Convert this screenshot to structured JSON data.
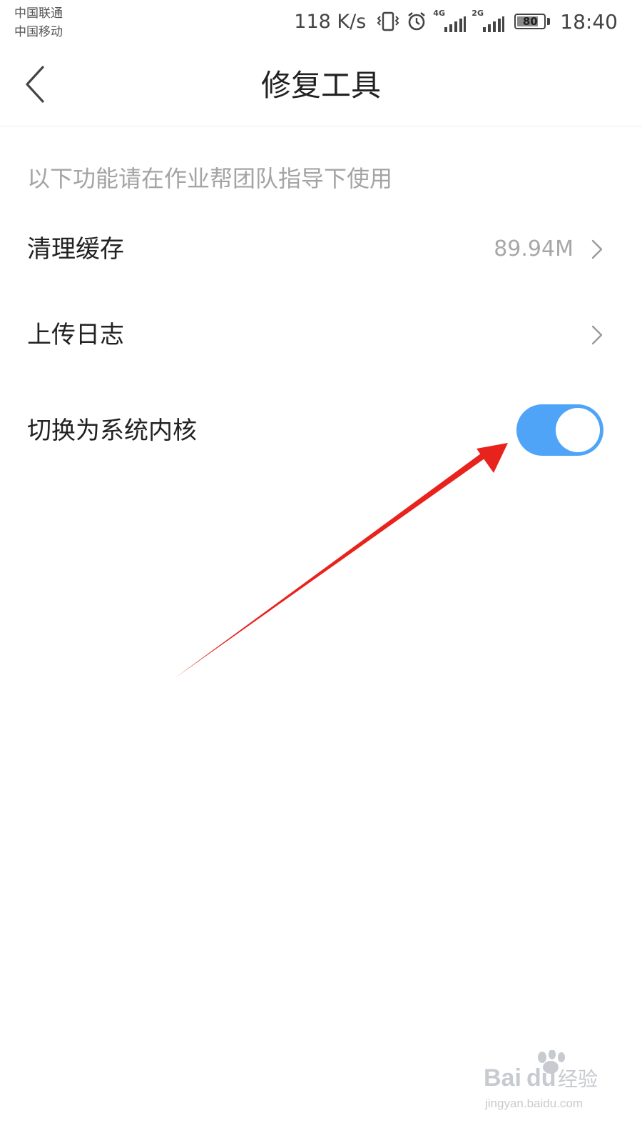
{
  "status_bar": {
    "carrier_1": "中国联通",
    "carrier_2": "中国移动",
    "net_speed": "118 K/s",
    "signal_1_tag": "4G",
    "signal_2_tag": "2G",
    "battery_level": "80",
    "time": "18:40",
    "icons": [
      "vibrate-icon",
      "alarm-icon",
      "signal-4g-icon",
      "signal-2g-icon",
      "battery-icon"
    ]
  },
  "nav": {
    "back_icon": "chevron-left-icon",
    "title": "修复工具"
  },
  "section": {
    "hint": "以下功能请在作业帮团队指导下使用"
  },
  "rows": [
    {
      "label": "清理缓存",
      "value": "89.94M",
      "icon": "chevron-right-icon"
    },
    {
      "label": "上传日志",
      "value": "",
      "icon": "chevron-right-icon"
    },
    {
      "label": "切换为系统内核",
      "toggle_on": true
    }
  ],
  "colors": {
    "toggle_on": "#4fa4f8",
    "annotation_arrow": "#e8231d",
    "hint_text": "#a4a4a4"
  },
  "watermark": {
    "brand": "Baidu经验",
    "url": "jingyan.baidu.com"
  }
}
